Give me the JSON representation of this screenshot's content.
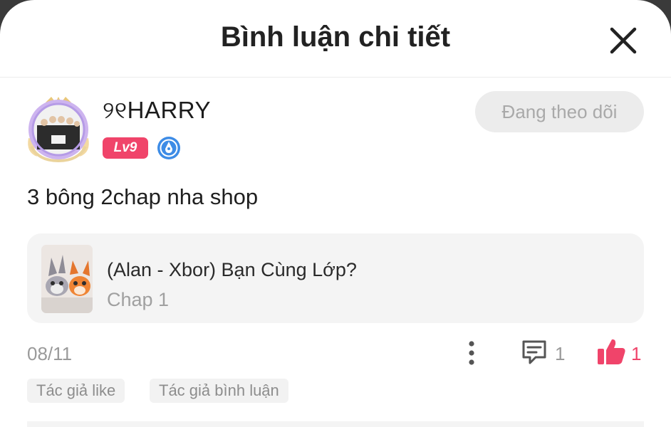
{
  "header": {
    "title": "Bình luận chi tiết"
  },
  "comment": {
    "username": "୨୧HARRY",
    "level_badge": "Lv9",
    "follow_label": "Đang theo dõi",
    "text": "3 bông 2chap nha shop",
    "date": "08/11",
    "reply_count": "1",
    "like_count": "1",
    "tags": [
      "Tác giả like",
      "Tác giả bình luận"
    ]
  },
  "story": {
    "title": "(Alan - Xbor) Bạn Cùng Lớp?",
    "chapter": "Chap 1"
  },
  "colors": {
    "accent": "#f0446a",
    "follow_bg": "#ececec",
    "muted_text": "#9a9a9a",
    "card_bg": "#f4f4f4"
  },
  "icons": {
    "close": "close-icon",
    "more": "more-vertical-icon",
    "reply": "comment-icon",
    "like": "thumbs-up-icon",
    "pen_badge": "pen-badge-icon"
  }
}
